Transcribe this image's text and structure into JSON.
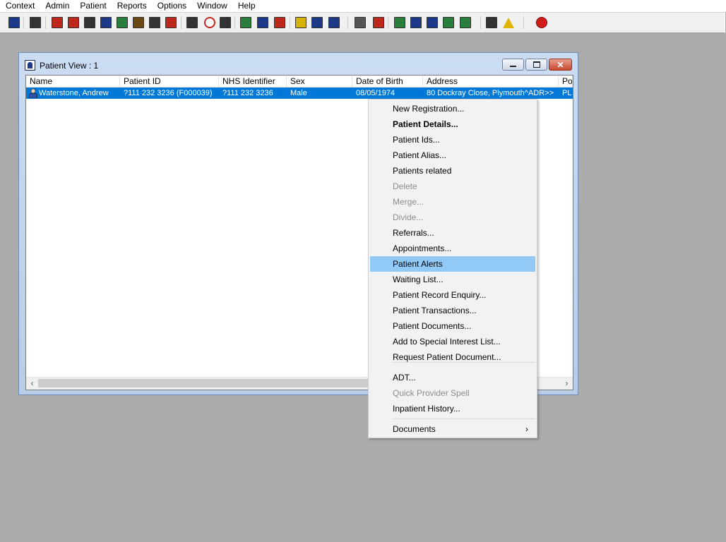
{
  "menubar": {
    "items": [
      "Context",
      "Admin",
      "Patient",
      "Reports",
      "Options",
      "Window",
      "Help"
    ]
  },
  "toolbar": {
    "icons": [
      {
        "name": "patient-icon",
        "color": "#1d3a8a"
      },
      {
        "name": "printer-icon",
        "color": "#333333"
      },
      {
        "name": "book-red-icon",
        "color": "#c0271c"
      },
      {
        "name": "form-icon",
        "color": "#c0271c"
      },
      {
        "name": "list-icon",
        "color": "#333333"
      },
      {
        "name": "m-letter-icon",
        "color": "#1d3a8a"
      },
      {
        "name": "doctor-icon",
        "color": "#2a7d3b"
      },
      {
        "name": "notes-icon",
        "color": "#6b4a14"
      },
      {
        "name": "handshake-icon",
        "color": "#333333"
      },
      {
        "name": "flag-icon",
        "color": "#c0271c"
      },
      {
        "name": "search-record-icon",
        "color": "#333333"
      },
      {
        "name": "clock-icon",
        "color": "#c0271c"
      },
      {
        "name": "monitor-icon",
        "color": "#333333"
      },
      {
        "name": "card-icon",
        "color": "#2a7d3b"
      },
      {
        "name": "window-icon",
        "color": "#1d3a8a"
      },
      {
        "name": "no-entry-icon",
        "color": "#c0271c"
      },
      {
        "name": "note-yellow-icon",
        "color": "#d6b300"
      },
      {
        "name": "bed-icon",
        "color": "#1d3a8a"
      },
      {
        "name": "ambulance-icon",
        "color": "#1d3a8a"
      },
      {
        "name": "document-icon",
        "color": "#555555"
      },
      {
        "name": "bar-chart-icon",
        "color": "#c0271c"
      },
      {
        "name": "globe-icon",
        "color": "#2a7d3b"
      },
      {
        "name": "inbox-icon",
        "color": "#1d3a8a"
      },
      {
        "name": "download-icon",
        "color": "#1d3a8a"
      },
      {
        "name": "refresh-icon",
        "color": "#2a7d3b"
      },
      {
        "name": "export-icon",
        "color": "#2a7d3b"
      },
      {
        "name": "transfer-icon",
        "color": "#333333"
      },
      {
        "name": "warning-icon",
        "color": "#e0b400"
      },
      {
        "name": "exit-icon",
        "color": "#d21c1c"
      }
    ]
  },
  "window": {
    "title": "Patient View : 1",
    "columns": [
      "Name",
      "Patient ID",
      "NHS Identifier",
      "Sex",
      "Date of Birth",
      "Address",
      "Po"
    ],
    "rows": [
      {
        "name": "Waterstone, Andrew",
        "patient_id": "?111 232 3236 (F000039)",
        "nhs": "?111 232 3236",
        "sex": "Male",
        "dob": "08/05/1974",
        "address": "80 Dockray Close, Plymouth^ADR>>",
        "po": "PL"
      }
    ]
  },
  "context_menu": {
    "items": [
      {
        "label": "New Registration...",
        "state": "normal"
      },
      {
        "label": "Patient Details...",
        "state": "bold"
      },
      {
        "label": "Patient Ids...",
        "state": "normal"
      },
      {
        "label": "Patient Alias...",
        "state": "normal"
      },
      {
        "label": "Patients related",
        "state": "normal"
      },
      {
        "label": "Delete",
        "state": "disabled"
      },
      {
        "label": "Merge...",
        "state": "disabled"
      },
      {
        "label": "Divide...",
        "state": "disabled"
      },
      {
        "label": "Referrals...",
        "state": "normal"
      },
      {
        "label": "Appointments...",
        "state": "normal"
      },
      {
        "label": "Patient Alerts",
        "state": "highlighted"
      },
      {
        "label": "Waiting List...",
        "state": "normal"
      },
      {
        "label": "Patient Record Enquiry...",
        "state": "normal"
      },
      {
        "label": "Patient Transactions...",
        "state": "normal"
      },
      {
        "label": "Patient Documents...",
        "state": "normal"
      },
      {
        "label": "Add to Special Interest List...",
        "state": "normal"
      },
      {
        "label": "Request Patient Document...",
        "state": "normal"
      },
      {
        "label": "ADT...",
        "state": "normal"
      },
      {
        "label": "Quick Provider Spell",
        "state": "disabled"
      },
      {
        "label": "Inpatient History...",
        "state": "normal"
      },
      {
        "label": "Documents",
        "state": "submenu"
      }
    ],
    "submenu_arrow": "›"
  }
}
